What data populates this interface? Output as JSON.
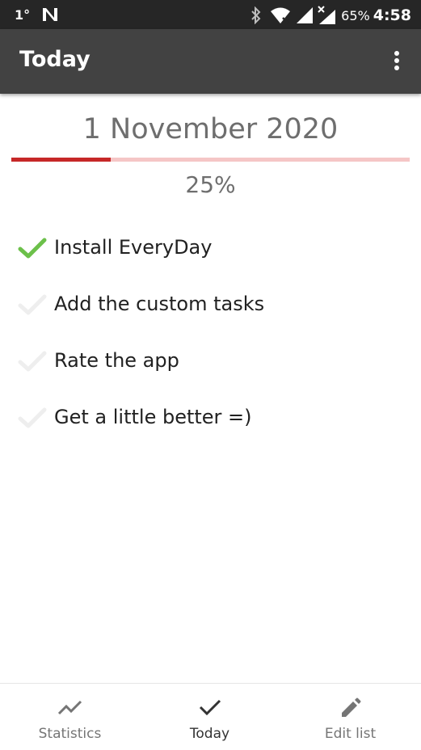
{
  "status_bar": {
    "temperature": "1°",
    "battery_percent": "65%",
    "time": "4:58"
  },
  "app_bar": {
    "title": "Today",
    "overflow_icon": "more-vert-icon"
  },
  "day": {
    "date": "1 November 2020",
    "progress_percent": "25%",
    "progress_fraction": 0.25,
    "colors": {
      "progress_fill": "#c62828",
      "progress_track": "#f5c6c6",
      "check_done": "#6cc04a",
      "check_pending": "#eeeeee"
    }
  },
  "tasks": [
    {
      "label": "Install EveryDay",
      "done": true
    },
    {
      "label": "Add the custom tasks",
      "done": false
    },
    {
      "label": "Rate the app",
      "done": false
    },
    {
      "label": "Get a little better =)",
      "done": false
    }
  ],
  "bottom_nav": {
    "items": [
      {
        "label": "Statistics",
        "icon": "trending-up-icon",
        "active": false
      },
      {
        "label": "Today",
        "icon": "check-icon",
        "active": true
      },
      {
        "label": "Edit list",
        "icon": "pencil-icon",
        "active": false
      }
    ]
  }
}
